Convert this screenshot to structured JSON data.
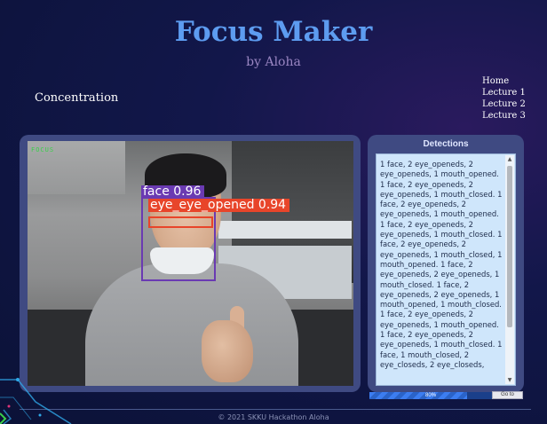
{
  "app": {
    "title": "Focus Maker",
    "subtitle": "by Aloha",
    "section_label": "Concentration"
  },
  "nav": {
    "items": [
      "Home",
      "Lecture 1",
      "Lecture 2",
      "Lecture 3"
    ]
  },
  "video": {
    "overlay_label": "FOCUS",
    "detections": [
      {
        "label": "face 0.96",
        "color": "#6a3ab2"
      },
      {
        "label": "eye_eye_opened 0.94",
        "color": "#e8452a"
      }
    ]
  },
  "detections_panel": {
    "title": "Detections",
    "log": "1 face, 2 eye_openeds, 2 eye_openeds, 1 mouth_opened. 1 face, 2 eye_openeds, 2 eye_openeds, 1 mouth_closed. 1 face, 2 eye_openeds, 2 eye_openeds, 1 mouth_opened. 1 face, 2 eye_openeds, 2 eye_openeds, 1 mouth_closed. 1 face, 2 eye_openeds, 2 eye_openeds, 1 mouth_closed, 1 mouth_opened. 1 face, 2 eye_openeds, 2 eye_openeds, 1 mouth_closed. 1 face, 2 eye_openeds, 2 eye_openeds, 1 mouth_opened, 1 mouth_closed. 1 face, 2 eye_openeds, 2 eye_openeds, 1 mouth_opened. 1 face, 2 eye_openeds, 2 eye_openeds, 1 mouth_closed. 1 face, 1 mouth_closed, 2 eye_closeds, 2 eye_closeds,"
  },
  "progress": {
    "value_percent": 80,
    "label": "80%",
    "goto_label": "Go to"
  },
  "footer": {
    "text": "© 2021 SKKU Hackathon Aloha"
  },
  "colors": {
    "title": "#5d9cf0",
    "subtitle": "#9a86c2",
    "panel": "#3f4a82",
    "progress": "#3c7df0"
  }
}
